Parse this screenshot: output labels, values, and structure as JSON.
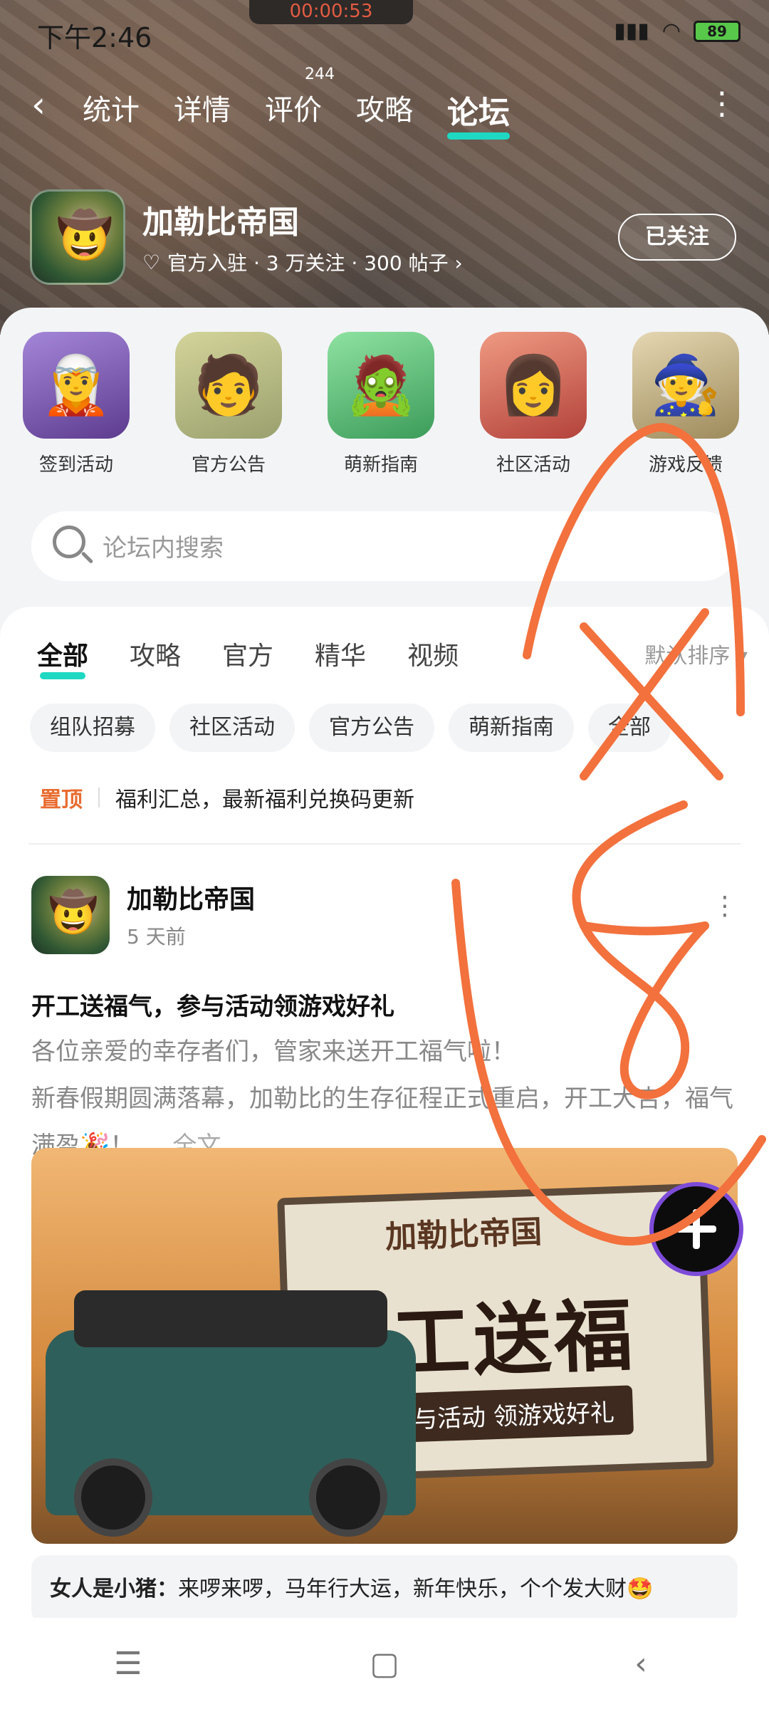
{
  "status": {
    "time": "下午2:46",
    "timer": "00:00:53",
    "battery": "89"
  },
  "nav": {
    "back_icon": "chevron-left-icon",
    "tabs": [
      {
        "label": "统计",
        "active": false
      },
      {
        "label": "详情",
        "active": false
      },
      {
        "label": "评价",
        "active": false,
        "badge": "244"
      },
      {
        "label": "攻略",
        "active": false
      },
      {
        "label": "论坛",
        "active": true
      }
    ],
    "more_icon": "more-vertical-icon"
  },
  "game": {
    "name": "加勒比帝国",
    "meta": "官方入驻 · 3 万关注 · 300 帖子 ›",
    "follow_label": "已关注"
  },
  "quick_links": [
    {
      "label": "签到活动"
    },
    {
      "label": "官方公告"
    },
    {
      "label": "萌新指南"
    },
    {
      "label": "社区活动"
    },
    {
      "label": "游戏反馈"
    }
  ],
  "search": {
    "placeholder": "论坛内搜索"
  },
  "feed": {
    "tabs": [
      {
        "label": "全部",
        "active": true
      },
      {
        "label": "攻略",
        "active": false
      },
      {
        "label": "官方",
        "active": false
      },
      {
        "label": "精华",
        "active": false
      },
      {
        "label": "视频",
        "active": false
      }
    ],
    "sort_label": "默认排序 ▾",
    "chips": [
      "组队招募",
      "社区活动",
      "官方公告",
      "萌新指南",
      "全部"
    ],
    "pinned": {
      "tag": "置顶",
      "text": "福利汇总，最新福利兑换码更新"
    }
  },
  "post": {
    "author": "加勒比帝国",
    "time": "5 天前",
    "title": "开工送福气，参与活动领游戏好礼",
    "body_line1": "各位亲爱的幸存者们，管家来送开工福气啦！",
    "body_line2": "新春假期圆满落幕，加勒比的生存征程正式重启，开工大吉，福气满盈🎉！",
    "readmore": " ... 全文",
    "image": {
      "logo": "加勒比帝国",
      "title": "开工送福气",
      "subtitle": "参与活动 领游戏好礼"
    },
    "comment_author": "女人是小猪：",
    "comment_text": "来啰来啰，马年行大运，新年快乐，个个发大财🤩"
  },
  "colors": {
    "accent": "#1ed8c2",
    "pin": "#e96b30",
    "scribble": "#f2713d"
  }
}
